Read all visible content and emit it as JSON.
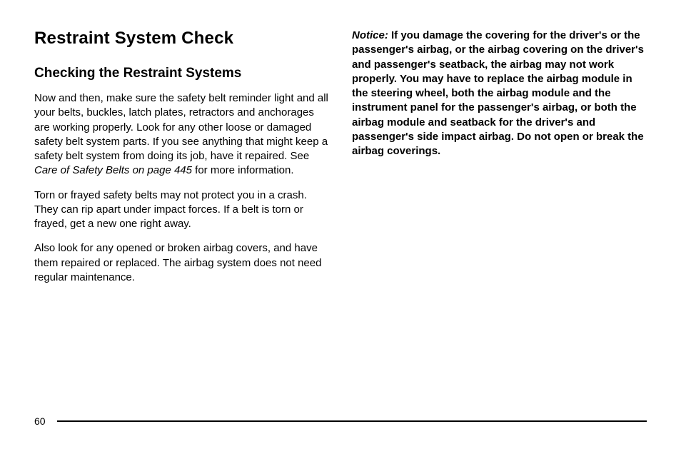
{
  "left": {
    "h1": "Restraint System Check",
    "h2": "Checking the Restraint Systems",
    "p1_part1": "Now and then, make sure the safety belt reminder light and all your belts, buckles, latch plates, retractors and anchorages are working properly. Look for any other loose or damaged safety belt system parts. If you see anything that might keep a safety belt system from doing its job, have it repaired. See ",
    "p1_italic": "Care of Safety Belts on page 445",
    "p1_part2": " for more information.",
    "p2": "Torn or frayed safety belts may not protect you in a crash. They can rip apart under impact forces. If a belt is torn or frayed, get a new one right away.",
    "p3": "Also look for any opened or broken airbag covers, and have them repaired or replaced. The airbag system does not need regular maintenance."
  },
  "right": {
    "notice_label": "Notice:",
    "notice_text": "   If you damage the covering for the driver's or the passenger's airbag, or the airbag covering on the driver's and passenger's seatback, the airbag may not work properly. You may have to replace the airbag module in the steering wheel, both the airbag module and the instrument panel for the passenger's airbag, or both the airbag module and seatback for the driver's and passenger's side impact airbag. Do not open or break the airbag coverings."
  },
  "page_number": "60"
}
